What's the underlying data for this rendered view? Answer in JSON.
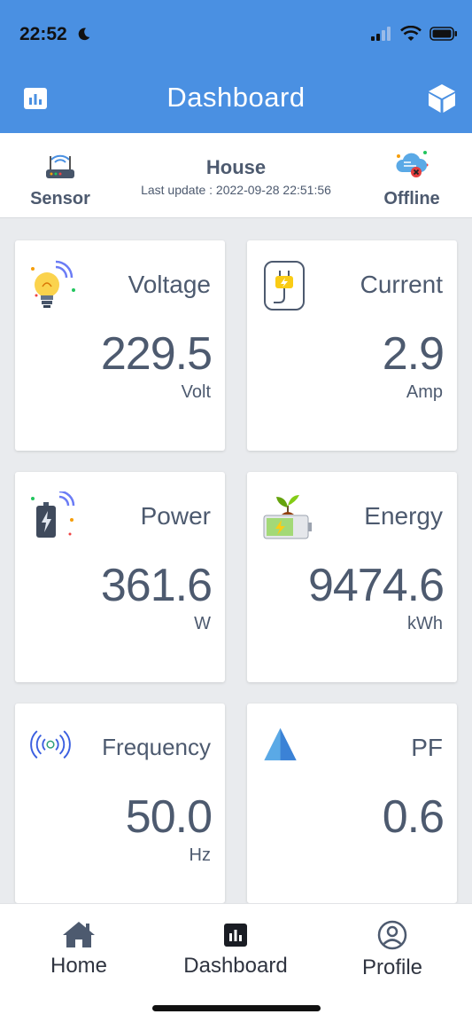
{
  "status_bar": {
    "time": "22:52"
  },
  "header": {
    "title": "Dashboard",
    "left_icon": "bar-chart-icon",
    "right_icon": "cube-icon"
  },
  "infobar": {
    "sensor_label": "Sensor",
    "house_name": "House",
    "last_update": "Last update : 2022-09-28 22:51:56",
    "status_label": "Offline"
  },
  "cards": {
    "voltage": {
      "title": "Voltage",
      "value": "229.5",
      "unit": "Volt",
      "icon": "smart-bulb-icon"
    },
    "current": {
      "title": "Current",
      "value": "2.9",
      "unit": "Amp",
      "icon": "plug-icon"
    },
    "power": {
      "title": "Power",
      "value": "361.6",
      "unit": "W",
      "icon": "battery-icon"
    },
    "energy": {
      "title": "Energy",
      "value": "9474.6",
      "unit": "kWh",
      "icon": "eco-battery-icon"
    },
    "frequency": {
      "title": "Frequency",
      "value": "50.0",
      "unit": "Hz",
      "icon": "signal-waves-icon"
    },
    "pf": {
      "title": "PF",
      "value": "0.6",
      "unit": "",
      "icon": "navigation-arrow-icon"
    }
  },
  "nav": {
    "home": "Home",
    "dashboard": "Dashboard",
    "profile": "Profile"
  },
  "colors": {
    "accent": "#4a90e2",
    "text": "#4d5a6f",
    "background": "#e9ebee"
  }
}
